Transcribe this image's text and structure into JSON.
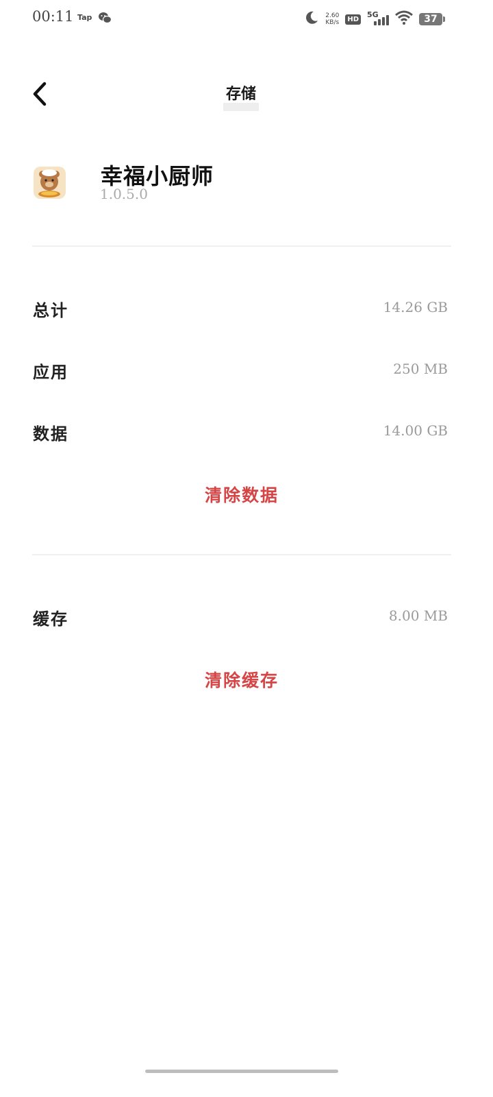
{
  "status_bar": {
    "time": "00:11",
    "tap_label": "Tap",
    "net_speed_value": "2.60",
    "net_speed_unit": "KB/s",
    "hd_label": "HD",
    "network_label": "5G",
    "battery_level": "37"
  },
  "header": {
    "title": "存储"
  },
  "app": {
    "name": "幸福小厨师",
    "version": "1.0.5.0"
  },
  "storage": {
    "rows": [
      {
        "label": "总计",
        "value": "14.26 GB"
      },
      {
        "label": "应用",
        "value": "250 MB"
      },
      {
        "label": "数据",
        "value": "14.00 GB"
      }
    ],
    "clear_data_label": "清除数据"
  },
  "cache": {
    "label": "缓存",
    "value": "8.00 MB",
    "clear_cache_label": "清除缓存"
  },
  "colors": {
    "accent_red": "#d54545",
    "value_gray": "#9a9a9a"
  }
}
